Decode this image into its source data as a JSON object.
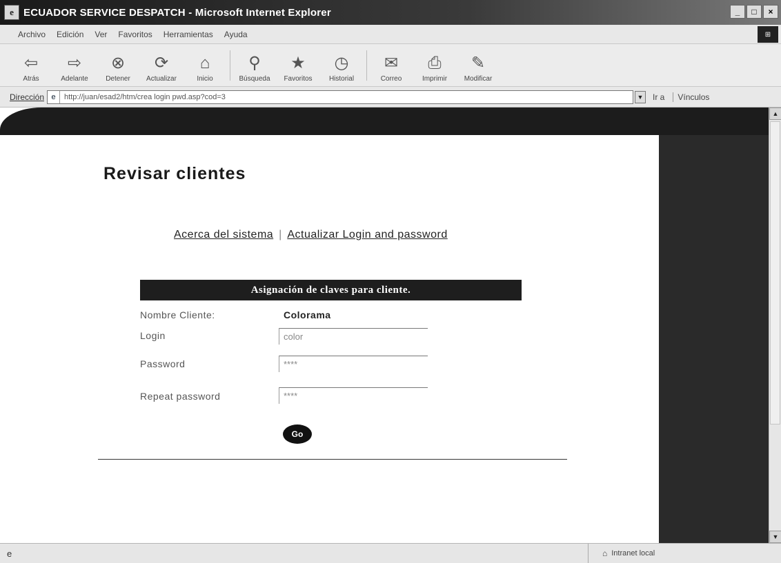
{
  "window": {
    "title": "ECUADOR SERVICE DESPATCH - Microsoft Internet Explorer",
    "icon": "ie-page-icon",
    "buttons": {
      "minimize": "_",
      "maximize": "□",
      "close": "×"
    }
  },
  "menubar": {
    "items": [
      "Archivo",
      "Edición",
      "Ver",
      "Favoritos",
      "Herramientas",
      "Ayuda"
    ]
  },
  "toolbar": {
    "buttons": [
      {
        "label": "Atrás",
        "icon": "back-arrow-icon",
        "glyph": "⇦"
      },
      {
        "label": "Adelante",
        "icon": "forward-arrow-icon",
        "glyph": "⇨"
      },
      {
        "label": "Detener",
        "icon": "stop-icon",
        "glyph": "⊗"
      },
      {
        "label": "Actualizar",
        "icon": "refresh-icon",
        "glyph": "⟳"
      },
      {
        "label": "Inicio",
        "icon": "home-icon",
        "glyph": "⌂"
      },
      {
        "label": "Búsqueda",
        "icon": "search-icon",
        "glyph": "⚲"
      },
      {
        "label": "Favoritos",
        "icon": "favorites-icon",
        "glyph": "★"
      },
      {
        "label": "Historial",
        "icon": "history-icon",
        "glyph": "◷"
      },
      {
        "label": "Correo",
        "icon": "mail-icon",
        "glyph": "✉"
      },
      {
        "label": "Imprimir",
        "icon": "print-icon",
        "glyph": "⎙"
      },
      {
        "label": "Modificar",
        "icon": "edit-icon",
        "glyph": "✎"
      }
    ]
  },
  "addressbar": {
    "label": "Dirección",
    "url": "http://juan/esad2/htm/crea login pwd.asp?cod=3",
    "go_label": "Ir a",
    "links_label": "Vínculos"
  },
  "page": {
    "heading": "Revisar clientes",
    "nav_links": {
      "about": "Acerca del sistema",
      "separator": "|",
      "update": "Actualizar Login and password"
    },
    "form": {
      "header": "Asignación de claves para cliente.",
      "client_label": "Nombre Cliente:",
      "client_value": "Colorama",
      "login_label": "Login",
      "login_value": "color",
      "password_label": "Password",
      "password_value": "****",
      "repeat_label": "Repeat password",
      "repeat_value": "****",
      "submit_label": "Go"
    }
  },
  "statusbar": {
    "zone": "Intranet local"
  }
}
